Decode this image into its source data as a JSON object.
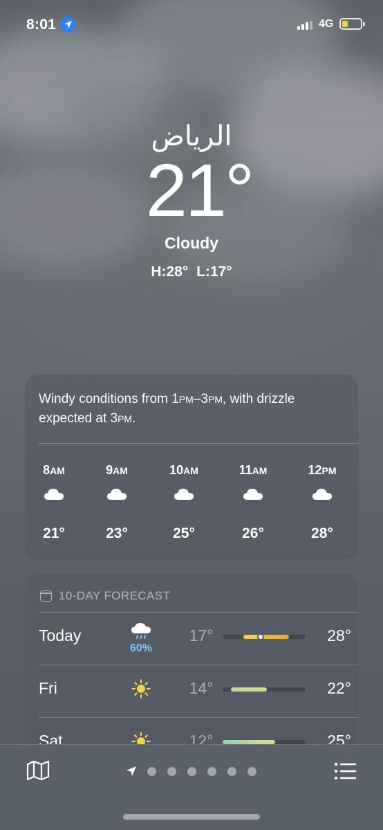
{
  "status_bar": {
    "time": "8:01",
    "network": "4G",
    "location_icon": "location-arrow-icon",
    "signal_icon": "cellular-signal-icon",
    "battery_icon": "battery-low-icon",
    "battery_color": "#f5cf3e"
  },
  "location": {
    "city": "الرياض",
    "temperature": "21°",
    "condition": "Cloudy",
    "high_low": "H:28° L:17°"
  },
  "hourly": {
    "summary_parts": [
      "Windy conditions from 1",
      "PM",
      "–3",
      "PM",
      ", with drizzle expected at 3",
      "PM",
      "."
    ],
    "hours": [
      {
        "num": "8",
        "suffix": "AM",
        "icon": "cloud-icon",
        "temp": "21°"
      },
      {
        "num": "9",
        "suffix": "AM",
        "icon": "cloud-icon",
        "temp": "23°"
      },
      {
        "num": "10",
        "suffix": "AM",
        "icon": "cloud-icon",
        "temp": "25°"
      },
      {
        "num": "11",
        "suffix": "AM",
        "icon": "cloud-icon",
        "temp": "26°"
      },
      {
        "num": "12",
        "suffix": "PM",
        "icon": "cloud-icon",
        "temp": "28°"
      }
    ]
  },
  "daily": {
    "header": "10-DAY FORECAST",
    "header_icon": "calendar-icon",
    "days": [
      {
        "name": "Today",
        "icon": "cloud-rain-icon",
        "precip": "60%",
        "low": "17°",
        "high": "28°",
        "range_start": 0.25,
        "range_end": 0.8,
        "current_marker": 0.46
      },
      {
        "name": "Fri",
        "icon": "sun-icon",
        "precip": "",
        "low": "14°",
        "high": "22°",
        "range_start": 0.1,
        "range_end": 0.53
      },
      {
        "name": "Sat",
        "icon": "sun-icon",
        "precip": "",
        "low": "12°",
        "high": "25°",
        "range_start": 0.0,
        "range_end": 0.63
      }
    ]
  },
  "bottom_bar": {
    "map_icon": "map-icon",
    "location_page_icon": "location-arrow-icon",
    "page_count": 6,
    "list_icon": "list-icon"
  }
}
